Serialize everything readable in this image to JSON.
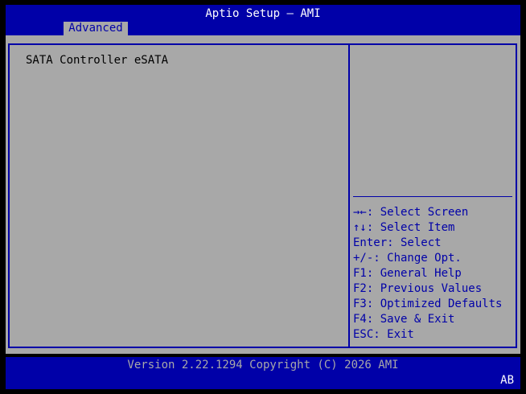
{
  "header": {
    "title": "Aptio Setup – AMI",
    "tabs": [
      {
        "label": "Advanced",
        "selected": true
      }
    ]
  },
  "main": {
    "items": [
      {
        "label": "SATA Controller eSATA"
      }
    ]
  },
  "help": {
    "keys": [
      "→←: Select Screen",
      "↑↓: Select Item",
      "Enter: Select",
      "+/-: Change Opt.",
      "F1: General Help",
      "F2: Previous Values",
      "F3: Optimized Defaults",
      "F4: Save & Exit",
      "ESC: Exit"
    ]
  },
  "footer": {
    "version": "Version 2.22.1294 Copyright (C) 2026 AMI",
    "code": "AB"
  },
  "colors": {
    "frame_blue": "#0000a8",
    "panel_gray": "#a8a8a8",
    "background": "#000000"
  }
}
